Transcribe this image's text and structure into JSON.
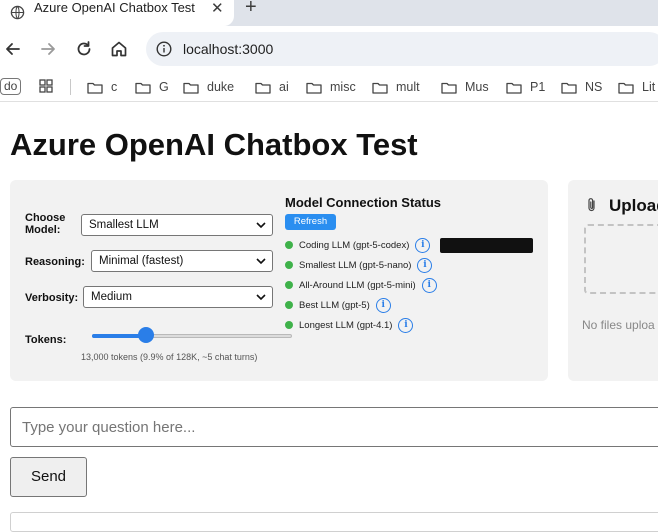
{
  "browser": {
    "tab_title": "Azure OpenAI Chatbox Test",
    "tab_close": "✕",
    "new_tab": "+",
    "url": "localhost:3000",
    "bookmark_chip": "do",
    "bookmarks": [
      "c",
      "G",
      "duke",
      "ai",
      "misc",
      "mult",
      "Mus",
      "P1",
      "NS",
      "Lit"
    ]
  },
  "page": {
    "title": "Azure OpenAI Chatbox Test"
  },
  "controls": {
    "model_label": "Choose Model:",
    "model_value": "Smallest LLM",
    "reasoning_label": "Reasoning:",
    "reasoning_value": "Minimal (fastest)",
    "verbosity_label": "Verbosity:",
    "verbosity_value": "Medium",
    "tokens_label": "Tokens:",
    "tokens_fraction": 0.27,
    "tokens_note": "13,000 tokens (9.9% of 128K, ~5 chat turns)"
  },
  "status": {
    "title": "Model Connection Status",
    "refresh_label": "Refresh",
    "info_glyph": "i",
    "ok_color": "#3fb24a",
    "models": [
      {
        "label": "Coding LLM (gpt-5-codex)"
      },
      {
        "label": "Smallest LLM (gpt-5-nano)"
      },
      {
        "label": "All-Around LLM (gpt-5-mini)"
      },
      {
        "label": "Best LLM (gpt-5)"
      },
      {
        "label": "Longest LLM (gpt-4.1)"
      }
    ]
  },
  "upload": {
    "title": "Upload",
    "empty_text": "No files uploa"
  },
  "chat": {
    "placeholder": "Type your question here...",
    "send_label": "Send"
  },
  "colors": {
    "accent": "#2a7ee8",
    "refresh": "#2a8ef0"
  }
}
